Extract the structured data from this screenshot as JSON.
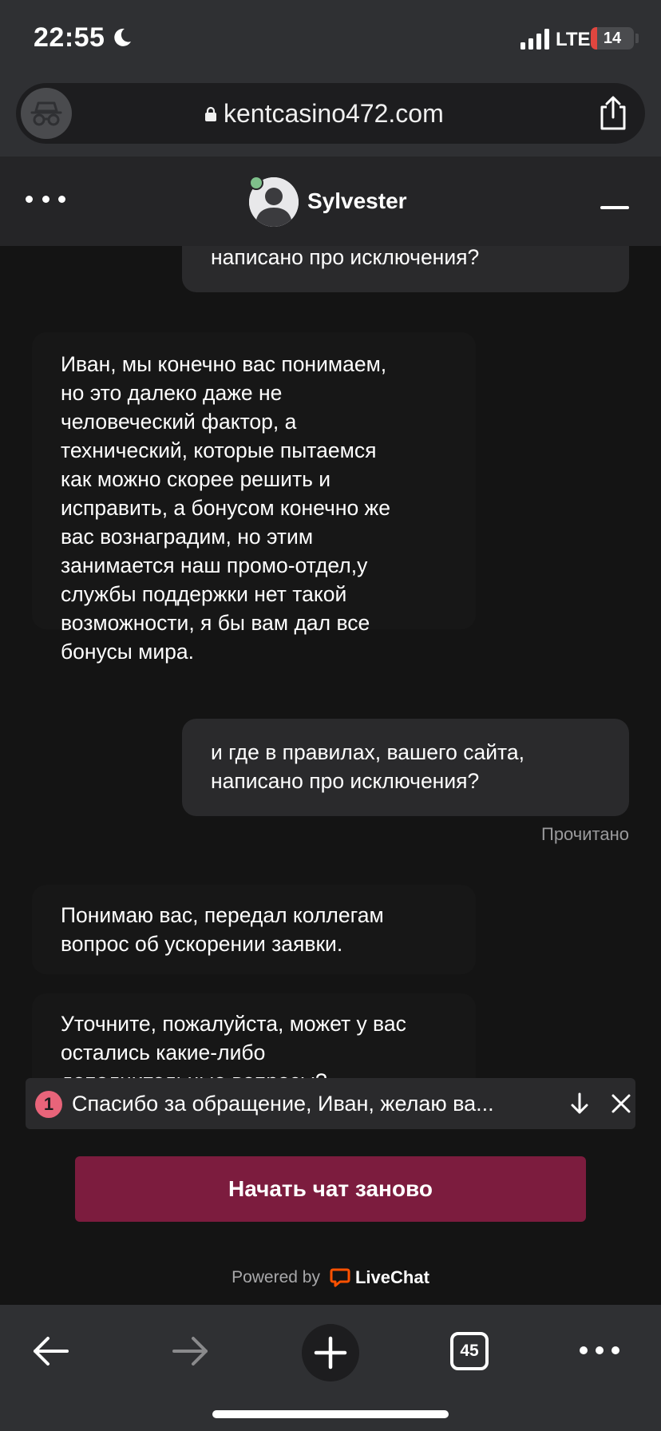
{
  "status_bar": {
    "time": "22:55",
    "network": "LTE",
    "battery_level": "14",
    "battery_fraction": 0.14,
    "icons": [
      "moon-icon",
      "signal-icon",
      "battery-charging-icon"
    ]
  },
  "browser": {
    "url": "kentcasino472.com",
    "icons": [
      "incognito-icon",
      "lock-icon",
      "share-icon"
    ]
  },
  "chat_header": {
    "agent_name": "Sylvester",
    "online_color": "#7fc08b"
  },
  "messages": [
    {
      "direction": "outgoing",
      "text": "написано про исключения?"
    },
    {
      "direction": "incoming",
      "lines": [
        "Иван, мы конечно вас понимаем,",
        "но это далеко даже не",
        "человеческий фактор, а",
        "технический, которые пытаемся",
        "как можно скорее решить и",
        "исправить, а бонусом конечно же",
        "вас вознаградим, но этим",
        "занимается наш промо-отдел,у",
        "службы поддержки нет такой",
        "возможности, я бы вам дал все",
        "бонусы мира."
      ]
    },
    {
      "direction": "outgoing",
      "lines": [
        "и где в правилах, вашего сайта,",
        "написано про исключения?"
      ],
      "status": "Прочитано"
    },
    {
      "direction": "incoming",
      "lines": [
        "Понимаю вас, передал коллегам",
        "вопрос об ускорении заявки."
      ]
    },
    {
      "direction": "incoming",
      "lines": [
        "Уточните, пожалуйста, может у вас",
        "остались какие-либо",
        "дополнительные вопросы?"
      ]
    }
  ],
  "notification": {
    "count": "1",
    "text": "Спасибо за обращение, Иван, желаю ва..."
  },
  "restart_button": {
    "label": "Начать чат заново",
    "color": "#7c1c3e"
  },
  "footer": {
    "powered_by": "Powered by",
    "brand": "LiveChat",
    "brand_color": "#ff5100"
  },
  "toolbar": {
    "tab_count": "45",
    "icons": [
      "back-arrow-icon",
      "forward-arrow-icon",
      "plus-icon",
      "tabs-icon",
      "more-dots-icon"
    ]
  }
}
